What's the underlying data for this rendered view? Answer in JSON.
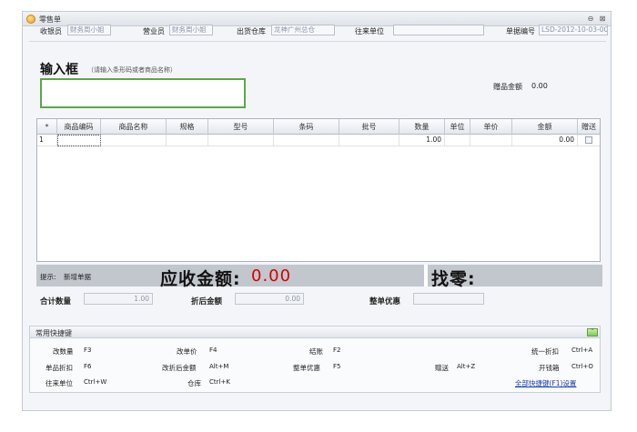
{
  "window": {
    "title": "零售单",
    "minimize_glyph": "⊖",
    "close_glyph": "⊠"
  },
  "header": {
    "cashier_label": "收银员",
    "cashier_value": "财务周小姐",
    "salesperson_label": "营业员",
    "salesperson_value": "财务周小姐",
    "warehouse_label": "出货仓库",
    "warehouse_value": "龙神广州总仓",
    "partner_label": "往来单位",
    "partner_value": "",
    "doc_no_label": "单据编号",
    "doc_no_value": "LSD-2012-10-03-00"
  },
  "input_box": {
    "title": "输入框",
    "hint": "（请输入条形码或者商品名称）",
    "value": ""
  },
  "gift": {
    "label": "赠品金额",
    "value": "0.00"
  },
  "grid": {
    "columns": [
      "*",
      "商品编码",
      "商品名称",
      "规格",
      "型号",
      "条码",
      "批号",
      "数量",
      "单位",
      "单价",
      "金额",
      "赠送"
    ],
    "rows": [
      {
        "index": "1",
        "code": "",
        "name": "",
        "spec": "",
        "model": "",
        "barcode": "",
        "batch": "",
        "qty": "1.00",
        "unit": "",
        "price": "",
        "amount": "0.00",
        "gift": false
      }
    ]
  },
  "status": {
    "hint_label": "提示:",
    "hint_value": "新增单据",
    "receivable_label": "应收金额:",
    "receivable_value": "0.00",
    "change_label": "找零:",
    "change_value": ""
  },
  "totals": {
    "qty_label": "合计数量",
    "qty_value": "1.00",
    "discount_label": "折后金额",
    "discount_value": "0.00",
    "order_discount_label": "整单优惠",
    "order_discount_value": ""
  },
  "shortcuts": {
    "title": "常用快捷键",
    "toggle_glyph": "˅",
    "items": [
      {
        "label": "改数量",
        "key": "F3"
      },
      {
        "label": "改单价",
        "key": "F4"
      },
      {
        "label": "结账",
        "key": "F2"
      },
      {
        "label": "统一折扣",
        "key": "Ctrl+A"
      },
      {
        "label": "单品折扣",
        "key": "F6"
      },
      {
        "label": "改折后金额",
        "key": "Alt+M"
      },
      {
        "label": "整单优惠",
        "key": "F5"
      },
      {
        "label": "赠送",
        "key": "Alt+Z"
      },
      {
        "label": "开钱箱",
        "key": "Ctrl+O"
      },
      {
        "label": "往来单位",
        "key": "Ctrl+W"
      },
      {
        "label": "仓库",
        "key": "Ctrl+K"
      }
    ],
    "settings_link": "全部快捷键(F1)设置"
  },
  "colors": {
    "accent_green": "#5aa846",
    "receivable_red": "#d40000",
    "status_bar_gray": "#c2c7ce",
    "link_blue": "#1a3fb0"
  }
}
